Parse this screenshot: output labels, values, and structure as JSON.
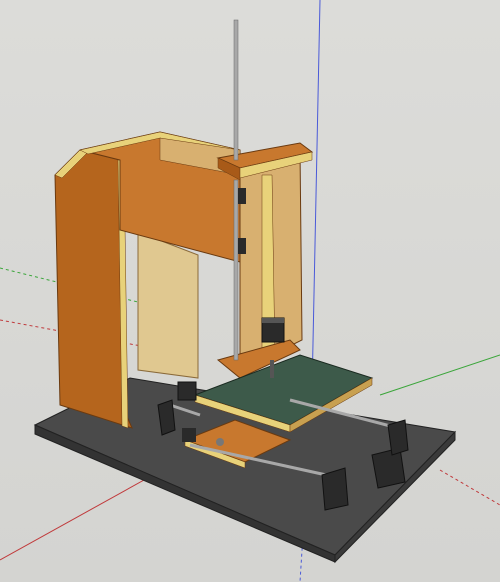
{
  "scene": {
    "description_label": "",
    "colors": {
      "background": "#d6d6d3",
      "base_plate": "#4a4a4a",
      "base_plate_top": "#5a5a58",
      "wood_dark": "#b5651d",
      "wood_mid": "#c8782e",
      "wood_light": "#d8b070",
      "wood_pale": "#e0c890",
      "edge_yellow": "#e8d27a",
      "bed_green": "#3d5a4a",
      "rod": "#a8a8a8",
      "motor": "#2a2a2a",
      "axis_red": "#c0393b",
      "axis_green": "#3aa53a",
      "axis_blue": "#4a5ad8"
    }
  }
}
